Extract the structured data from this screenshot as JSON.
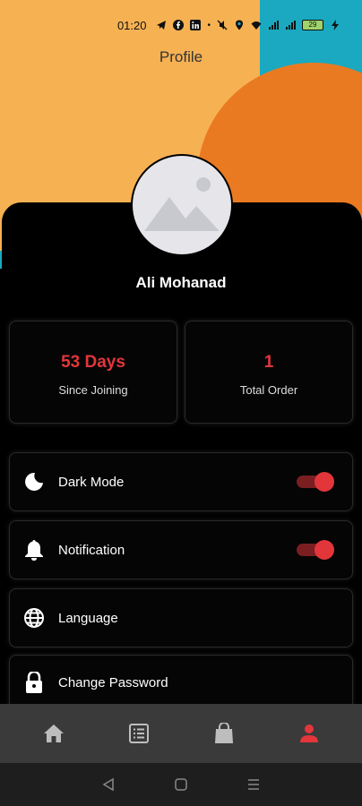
{
  "status_bar": {
    "time": "01:20",
    "battery": "29"
  },
  "header": {
    "title": "Profile"
  },
  "profile": {
    "name": "Ali Mohanad"
  },
  "stats": [
    {
      "value": "53 Days",
      "label": "Since Joining"
    },
    {
      "value": "1",
      "label": "Total Order"
    }
  ],
  "settings": {
    "dark_mode": {
      "label": "Dark Mode",
      "enabled": true
    },
    "notification": {
      "label": "Notification",
      "enabled": true
    },
    "language": {
      "label": "Language"
    },
    "change_password": {
      "label": "Change Password"
    }
  },
  "bottom_nav": {
    "items": [
      {
        "icon": "home-icon",
        "active": false
      },
      {
        "icon": "list-icon",
        "active": false
      },
      {
        "icon": "shopping-bag-icon",
        "active": false
      },
      {
        "icon": "person-icon",
        "active": true
      }
    ]
  },
  "colors": {
    "accent": "#e2363b",
    "yellow": "#f6b153",
    "orange": "#ea7a22",
    "teal": "#1aa9c0",
    "nav_bg": "#3a3a3a"
  }
}
